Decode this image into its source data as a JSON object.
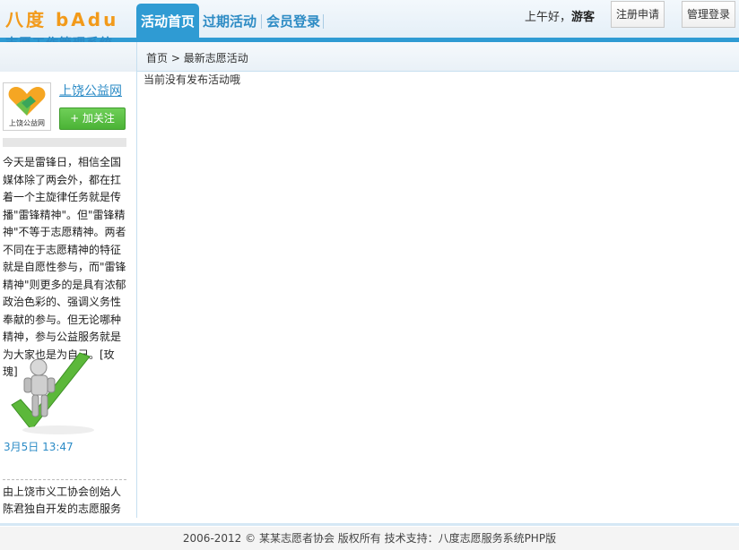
{
  "header": {
    "logo_title": "八度 bAdu",
    "logo_subtitle": "志愿工作管理系统",
    "nav": [
      {
        "label": "活动首页",
        "active": true
      },
      {
        "label": "过期活动",
        "active": false
      },
      {
        "label": "会员登录",
        "active": false
      }
    ],
    "greeting_prefix": "上午好，",
    "greeting_user": "游客",
    "register_label": "注册申请",
    "admin_label": "管理登录"
  },
  "sidebar": {
    "avatar_label": "上饶公益网",
    "profile_name": "上饶公益网",
    "follow_label": "+ 加关注",
    "post_text": "今天是雷锋日，相信全国媒体除了两会外，都在扛着一个主旋律任务就是传播\"雷锋精神\"。但\"雷锋精神\"不等于志愿精神。两者不同在于志愿精神的特征就是自愿性参与，而\"雷锋精神\"则更多的是具有浓郁政治色彩的、强调义务性奉献的参与。但无论哪种精神，参与公益服务就是为大家也是为自己。[玫瑰]",
    "post_time": "3月5日 13:47",
    "post2_text": "由上饶市义工协会创始人陈君独自开发的志愿服务"
  },
  "breadcrumb": {
    "home": "首页",
    "separator": " > ",
    "current": "最新志愿活动"
  },
  "main": {
    "empty_message": "当前没有发布活动哦"
  },
  "footer": {
    "text": "2006-2012 © 某某志愿者协会 版权所有  技术支持：八度志愿服务系统PHP版"
  },
  "colors": {
    "accent_blue": "#2f9bd3",
    "logo_orange": "#f29a1a",
    "follow_green": "#4bb336"
  }
}
